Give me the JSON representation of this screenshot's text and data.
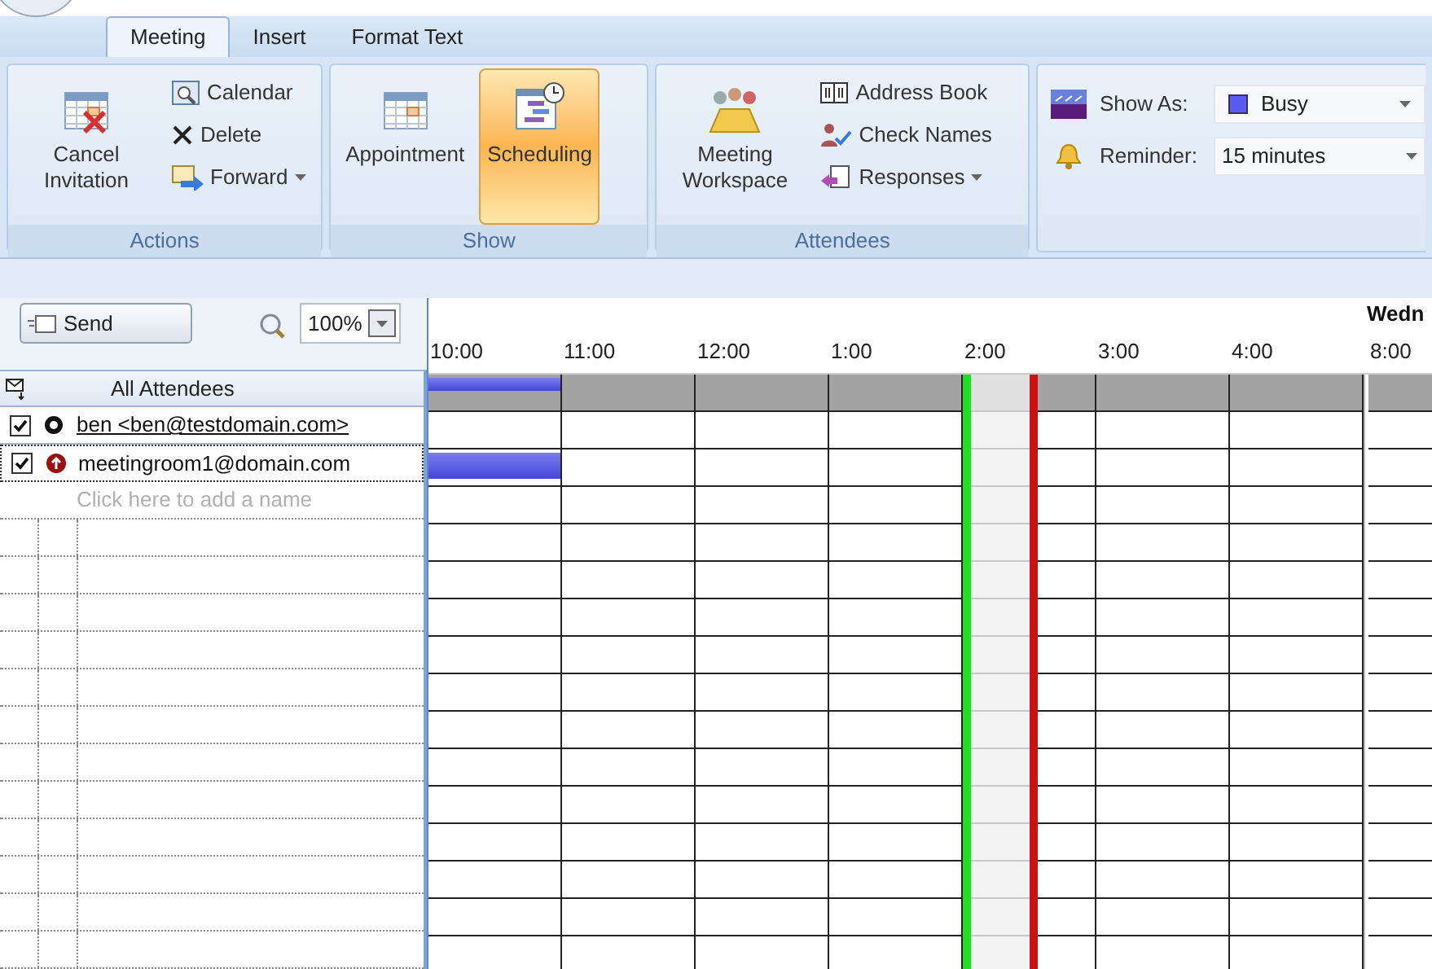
{
  "tabs": [
    {
      "label": "Meeting",
      "selected": true
    },
    {
      "label": "Insert",
      "selected": false
    },
    {
      "label": "Format Text",
      "selected": false
    }
  ],
  "ribbon": {
    "groups": [
      {
        "label": "Actions",
        "items": [
          {
            "kind": "large",
            "label": "Cancel Invitation"
          },
          {
            "kind": "small",
            "label": "Calendar",
            "dropdown": false
          },
          {
            "kind": "small",
            "label": "Delete",
            "dropdown": false
          },
          {
            "kind": "small",
            "label": "Forward",
            "dropdown": true
          }
        ]
      },
      {
        "label": "Show",
        "items": [
          {
            "kind": "large",
            "label": "Appointment",
            "selected": false
          },
          {
            "kind": "large",
            "label": "Scheduling",
            "selected": true
          }
        ]
      },
      {
        "label": "Attendees",
        "items": [
          {
            "kind": "large",
            "label": "Meeting Workspace"
          },
          {
            "kind": "small",
            "label": "Address Book",
            "dropdown": false
          },
          {
            "kind": "small",
            "label": "Check Names",
            "dropdown": false
          },
          {
            "kind": "small",
            "label": "Responses",
            "dropdown": true
          }
        ]
      }
    ],
    "options": {
      "show_as": {
        "label": "Show As:",
        "value": "Busy",
        "color": "#5b5bef"
      },
      "reminder": {
        "label": "Reminder:",
        "value": "15 minutes"
      }
    }
  },
  "scheduling": {
    "send_button": "Send",
    "zoom": "100%",
    "day_label": "Wedn",
    "times": [
      "10:00",
      "11:00",
      "12:00",
      "1:00",
      "2:00",
      "3:00",
      "4:00",
      "8:00"
    ],
    "all_attendees": {
      "label": "All Attendees",
      "busy": [
        true,
        false,
        false,
        false,
        false,
        false,
        false,
        false
      ]
    },
    "attendees": [
      {
        "name": "ben <ben@testdomain.com>",
        "kind": "organizer",
        "checked": true,
        "resolved": true,
        "selected": false,
        "busy": [
          false,
          false,
          false,
          false,
          false,
          false,
          false,
          false
        ]
      },
      {
        "name": "meetingroom1@domain.com",
        "kind": "resource",
        "checked": true,
        "resolved": false,
        "selected": true,
        "busy": [
          true,
          false,
          false,
          false,
          false,
          false,
          false,
          false
        ]
      }
    ],
    "add_placeholder": "Click here to add a name"
  }
}
